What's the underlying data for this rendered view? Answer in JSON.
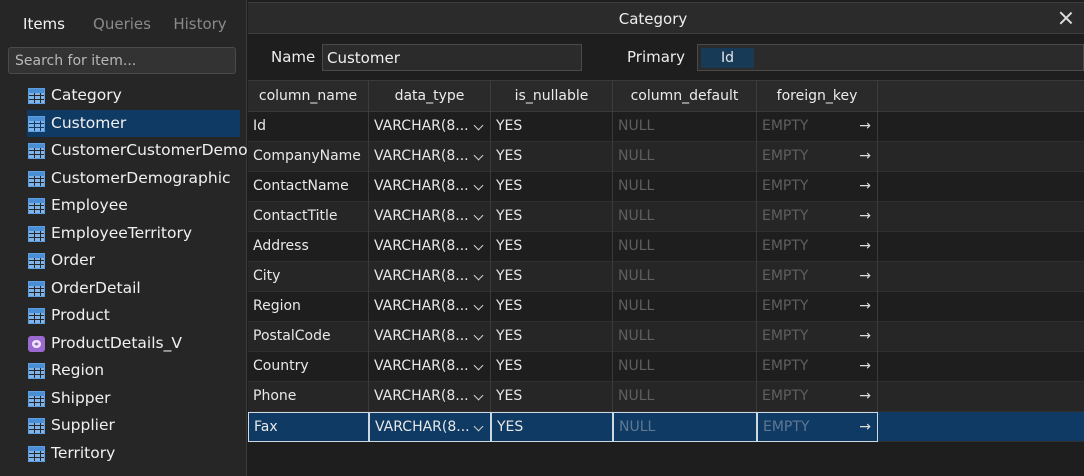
{
  "sidebar": {
    "tabs": [
      "Items",
      "Queries",
      "History"
    ],
    "active_tab": "Items",
    "search_placeholder": "Search for item...",
    "items": [
      {
        "label": "Category",
        "icon": "table-icon"
      },
      {
        "label": "Customer",
        "icon": "table-icon",
        "selected": true
      },
      {
        "label": "CustomerCustomerDemo",
        "icon": "table-icon"
      },
      {
        "label": "CustomerDemographic",
        "icon": "table-icon"
      },
      {
        "label": "Employee",
        "icon": "table-icon"
      },
      {
        "label": "EmployeeTerritory",
        "icon": "table-icon"
      },
      {
        "label": "Order",
        "icon": "table-icon"
      },
      {
        "label": "OrderDetail",
        "icon": "table-icon"
      },
      {
        "label": "Product",
        "icon": "table-icon"
      },
      {
        "label": "ProductDetails_V",
        "icon": "view-icon"
      },
      {
        "label": "Region",
        "icon": "table-icon"
      },
      {
        "label": "Shipper",
        "icon": "table-icon"
      },
      {
        "label": "Supplier",
        "icon": "table-icon"
      },
      {
        "label": "Territory",
        "icon": "table-icon"
      }
    ]
  },
  "editor": {
    "title": "Category",
    "name_label": "Name",
    "name_value": "Customer",
    "primary_label": "Primary",
    "primary_value": "Id"
  },
  "grid": {
    "columns": [
      "column_name",
      "data_type",
      "is_nullable",
      "column_default",
      "foreign_key"
    ],
    "rows": [
      {
        "column_name": "Id",
        "data_type": "VARCHAR(8...",
        "is_nullable": "YES",
        "column_default": "NULL",
        "foreign_key": "EMPTY"
      },
      {
        "column_name": "CompanyName",
        "data_type": "VARCHAR(8...",
        "is_nullable": "YES",
        "column_default": "NULL",
        "foreign_key": "EMPTY"
      },
      {
        "column_name": "ContactName",
        "data_type": "VARCHAR(8...",
        "is_nullable": "YES",
        "column_default": "NULL",
        "foreign_key": "EMPTY"
      },
      {
        "column_name": "ContactTitle",
        "data_type": "VARCHAR(8...",
        "is_nullable": "YES",
        "column_default": "NULL",
        "foreign_key": "EMPTY"
      },
      {
        "column_name": "Address",
        "data_type": "VARCHAR(8...",
        "is_nullable": "YES",
        "column_default": "NULL",
        "foreign_key": "EMPTY"
      },
      {
        "column_name": "City",
        "data_type": "VARCHAR(8...",
        "is_nullable": "YES",
        "column_default": "NULL",
        "foreign_key": "EMPTY"
      },
      {
        "column_name": "Region",
        "data_type": "VARCHAR(8...",
        "is_nullable": "YES",
        "column_default": "NULL",
        "foreign_key": "EMPTY"
      },
      {
        "column_name": "PostalCode",
        "data_type": "VARCHAR(8...",
        "is_nullable": "YES",
        "column_default": "NULL",
        "foreign_key": "EMPTY"
      },
      {
        "column_name": "Country",
        "data_type": "VARCHAR(8...",
        "is_nullable": "YES",
        "column_default": "NULL",
        "foreign_key": "EMPTY"
      },
      {
        "column_name": "Phone",
        "data_type": "VARCHAR(8...",
        "is_nullable": "YES",
        "column_default": "NULL",
        "foreign_key": "EMPTY"
      },
      {
        "column_name": "Fax",
        "data_type": "VARCHAR(8...",
        "is_nullable": "YES",
        "column_default": "NULL",
        "foreign_key": "EMPTY",
        "selected": true
      }
    ]
  },
  "colors": {
    "background": "#1e1e1e",
    "sidebar": "#262626",
    "selection": "#0f3a63",
    "table_icon": "#4a8fd6",
    "view_icon": "#9b6ad1"
  }
}
